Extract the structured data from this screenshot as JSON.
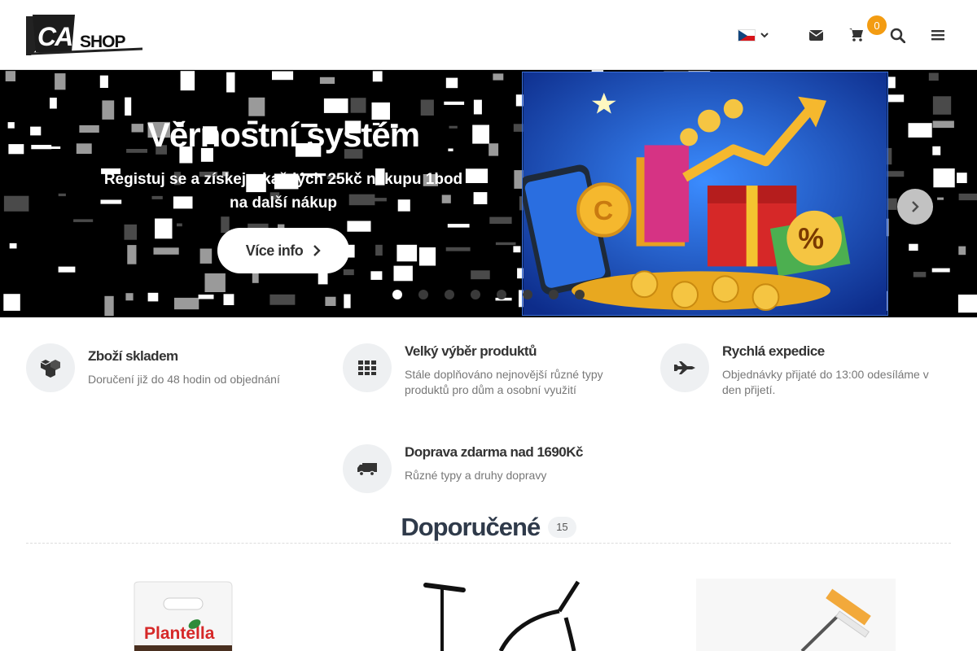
{
  "header": {
    "logo_text_a": "CAB",
    "logo_text_b": "SHOP",
    "language_flag": "cz",
    "cart_count": "0",
    "icons": [
      "envelope-icon",
      "cart-icon",
      "search-icon",
      "menu-icon"
    ]
  },
  "hero": {
    "title": "Věrnostní systém",
    "subtitle": "Registuj se a získej z každých 25kč nákupu 1bod na další nákup",
    "button_label": "Více info",
    "slides": 8,
    "active_slide": 1
  },
  "features": [
    {
      "icon": "boxes-icon",
      "title": "Zboží skladem",
      "desc": "Doručení již do 48 hodin od objednání"
    },
    {
      "icon": "grid-icon",
      "title": "Velký výběr produktů",
      "desc": "Stále doplňováno nejnovější různé typy produktů pro dům a osobní využití"
    },
    {
      "icon": "plane-icon",
      "title": "Rychlá expedice",
      "desc": "Objednávky přijaté do 13:00 odesíláme v den přijetí."
    },
    {
      "icon": "truck-icon",
      "title": "Doprava zdarma nad 1690Kč",
      "desc": "Různé typy a druhy dopravy"
    }
  ],
  "section": {
    "title": "Doporučené",
    "count": "15"
  },
  "products": [
    {
      "image": "plantella-soil-bag",
      "brand": "Plantella"
    },
    {
      "image": "bulb-planter-tool"
    },
    {
      "image": "window-squeegee-pole"
    }
  ],
  "colors": {
    "accent": "#f39c12",
    "heading": "#2f3a4a"
  }
}
